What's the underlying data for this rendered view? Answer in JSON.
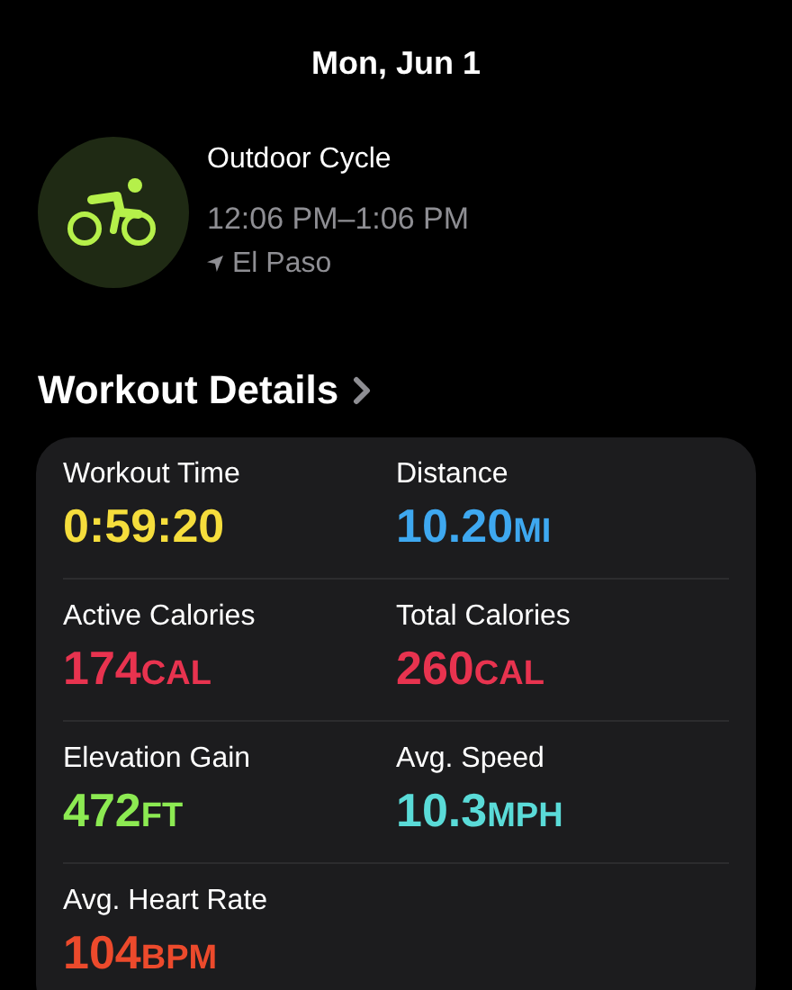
{
  "header": {
    "title": "Mon, Jun 1"
  },
  "workout": {
    "name": "Outdoor Cycle",
    "time": "12:06 PM–1:06 PM",
    "location": "El Paso"
  },
  "section": {
    "title": "Workout Details"
  },
  "metrics": [
    {
      "label": "Workout Time",
      "value": "0:59:20",
      "color": "#f5dd3c"
    },
    {
      "label": "Distance",
      "value": "10.20",
      "unit": "MI",
      "color": "#3ea8f0"
    },
    {
      "label": "Active Calories",
      "value": "174",
      "unit": "CAL",
      "color": "#e8334f"
    },
    {
      "label": "Total Calories",
      "value": "260",
      "unit": "CAL",
      "color": "#e8334f"
    },
    {
      "label": "Elevation Gain",
      "value": "472",
      "unit": "FT",
      "color": "#8cea52"
    },
    {
      "label": "Avg. Speed",
      "value": "10.3",
      "unit": "MPH",
      "color": "#5adbd8"
    },
    {
      "label": "Avg. Heart Rate",
      "value": "104",
      "unit": "BPM",
      "color": "#ec4a2c"
    }
  ]
}
